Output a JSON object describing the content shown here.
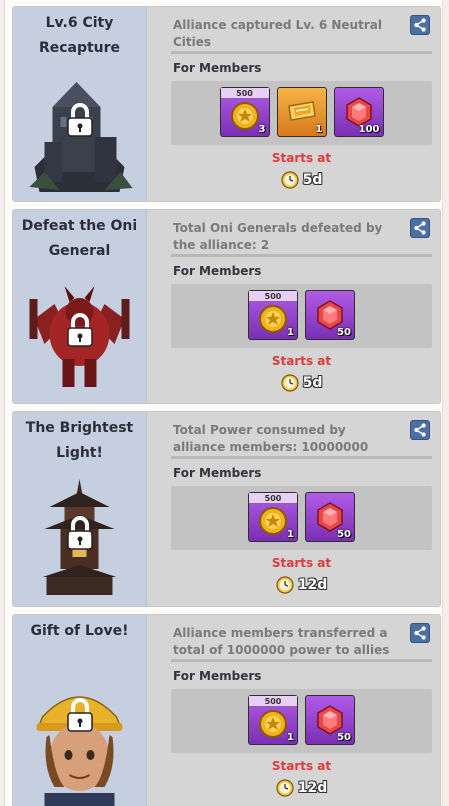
{
  "section_label": "For Members",
  "starts_label": "Starts at",
  "cards": [
    {
      "title": "Lv.6 City Recapture",
      "art": "dark-castle",
      "description": "Alliance captured Lv. 6 Neutral Cities",
      "rewards": [
        {
          "icon": "gold-medal-icon",
          "bg": "purple",
          "tag": "500",
          "qty": "3"
        },
        {
          "icon": "golden-ticket-icon",
          "bg": "orange",
          "tag": "",
          "qty": "1"
        },
        {
          "icon": "red-gem-icon",
          "bg": "purple",
          "tag": "",
          "qty": "100"
        }
      ],
      "countdown": "5d"
    },
    {
      "title": "Defeat the Oni General",
      "art": "oni-general",
      "description": "Total Oni Generals defeated by the alliance: 2",
      "rewards": [
        {
          "icon": "gold-medal-icon",
          "bg": "purple",
          "tag": "500",
          "qty": "1"
        },
        {
          "icon": "red-gem-icon",
          "bg": "purple",
          "tag": "",
          "qty": "50"
        }
      ],
      "countdown": "5d"
    },
    {
      "title": "The Brightest Light!",
      "art": "pagoda-lantern",
      "description": "Total Power consumed by alliance members: 10000000",
      "rewards": [
        {
          "icon": "gold-medal-icon",
          "bg": "purple",
          "tag": "500",
          "qty": "1"
        },
        {
          "icon": "red-gem-icon",
          "bg": "purple",
          "tag": "",
          "qty": "50"
        }
      ],
      "countdown": "12d"
    },
    {
      "title": "Gift of Love!",
      "art": "hardhat-character",
      "description": "Alliance members transferred a total of 1000000 power to allies",
      "rewards": [
        {
          "icon": "gold-medal-icon",
          "bg": "purple",
          "tag": "500",
          "qty": "1"
        },
        {
          "icon": "red-gem-icon",
          "bg": "purple",
          "tag": "",
          "qty": "50"
        }
      ],
      "countdown": "12d"
    }
  ]
}
